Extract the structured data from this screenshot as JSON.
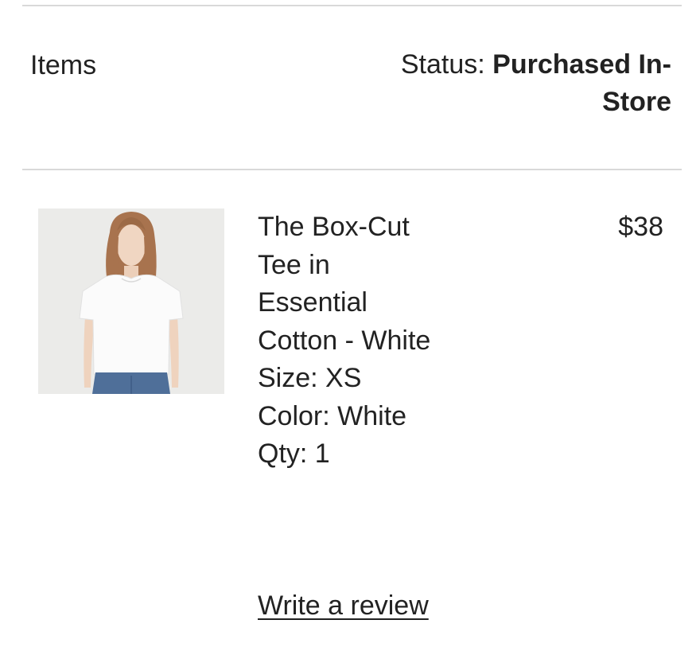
{
  "header": {
    "items_label": "Items",
    "status_prefix": "Status:",
    "status_value": "Purchased In-Store"
  },
  "product": {
    "image_icon": "product-photo-tee-icon",
    "name": "The Box-Cut Tee in Essential Cotton - White",
    "size": "Size: XS",
    "color": "Color: White",
    "qty": "Qty: 1",
    "price": "$38"
  },
  "actions": {
    "review_label": "Write a review"
  }
}
